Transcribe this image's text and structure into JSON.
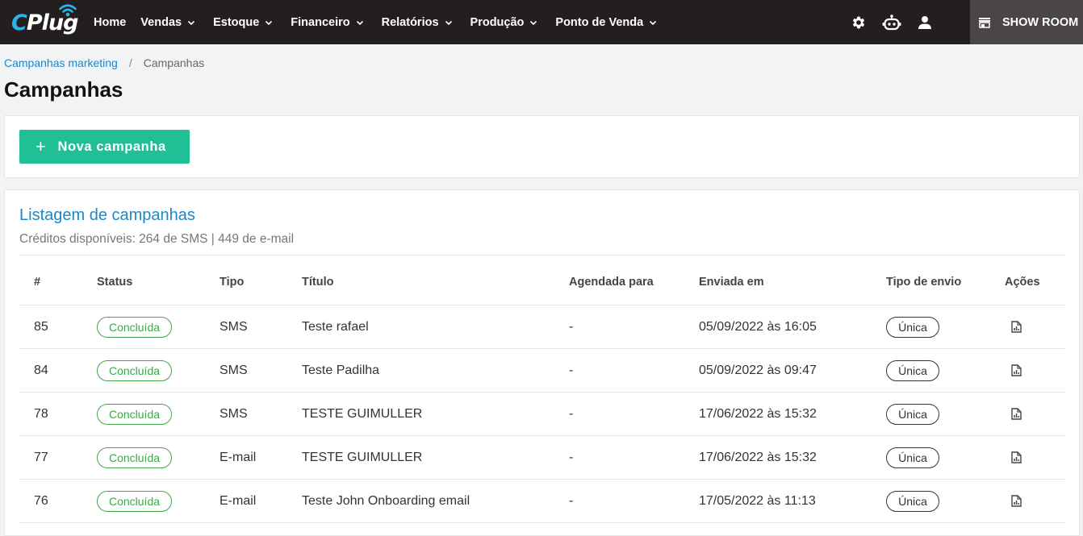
{
  "brand": {
    "logo_c": "C",
    "logo_rest": "Plug"
  },
  "nav": {
    "items": [
      {
        "label": "Home",
        "dropdown": false
      },
      {
        "label": "Vendas",
        "dropdown": true
      },
      {
        "label": "Estoque",
        "dropdown": true
      },
      {
        "label": "Financeiro",
        "dropdown": true
      },
      {
        "label": "Relatórios",
        "dropdown": true
      },
      {
        "label": "Produção",
        "dropdown": true
      },
      {
        "label": "Ponto de Venda",
        "dropdown": true
      }
    ],
    "icons": [
      "gear-icon",
      "robot-icon",
      "user-icon"
    ],
    "showroom_label": "SHOW ROOM"
  },
  "breadcrumb": {
    "parent": "Campanhas marketing",
    "separator": "/",
    "current": "Campanhas"
  },
  "page": {
    "title": "Campanhas"
  },
  "actions": {
    "new_campaign_label": "Nova campanha"
  },
  "list": {
    "title": "Listagem de campanhas",
    "credits": "Créditos disponíveis: 264 de SMS | 449 de e-mail",
    "columns": {
      "id": "#",
      "status": "Status",
      "tipo": "Tipo",
      "titulo": "Título",
      "agendada": "Agendada para",
      "enviada": "Enviada em",
      "tipo_envio": "Tipo de envio",
      "acoes": "Ações"
    },
    "rows": [
      {
        "id": "85",
        "status": "Concluída",
        "tipo": "SMS",
        "titulo": "Teste rafael",
        "agendada": "-",
        "enviada": "05/09/2022 às 16:05",
        "tipo_envio": "Única"
      },
      {
        "id": "84",
        "status": "Concluída",
        "tipo": "SMS",
        "titulo": "Teste Padilha",
        "agendada": "-",
        "enviada": "05/09/2022 às 09:47",
        "tipo_envio": "Única"
      },
      {
        "id": "78",
        "status": "Concluída",
        "tipo": "SMS",
        "titulo": "TESTE GUIMULLER",
        "agendada": "-",
        "enviada": "17/06/2022 às 15:32",
        "tipo_envio": "Única"
      },
      {
        "id": "77",
        "status": "Concluída",
        "tipo": "E-mail",
        "titulo": "TESTE GUIMULLER",
        "agendada": "-",
        "enviada": "17/06/2022 às 15:32",
        "tipo_envio": "Única"
      },
      {
        "id": "76",
        "status": "Concluída",
        "tipo": "E-mail",
        "titulo": "Teste John Onboarding email",
        "agendada": "-",
        "enviada": "17/05/2022 às 11:13",
        "tipo_envio": "Única"
      }
    ]
  },
  "colors": {
    "topbar": "#231f1e",
    "accent": "#20bf95",
    "link": "#1b87c9",
    "status_green": "#3fa54a",
    "logo_blue": "#2bb3f0"
  }
}
